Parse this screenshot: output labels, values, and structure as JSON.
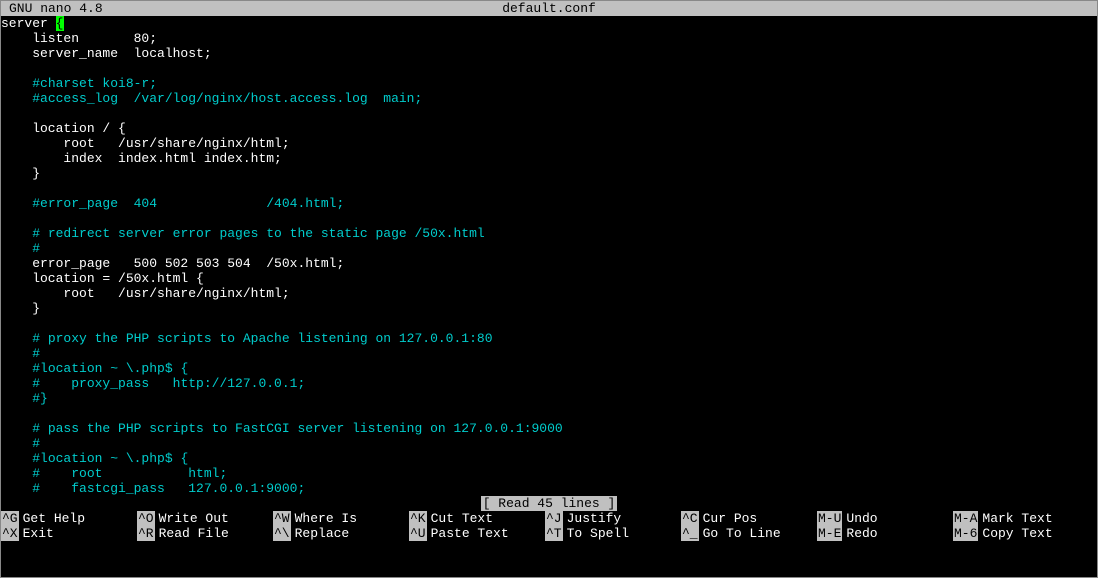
{
  "titlebar": {
    "app": "  GNU nano 4.8",
    "filename": "default.conf"
  },
  "editor": {
    "lines": [
      {
        "segments": [
          {
            "t": "server ",
            "c": "white"
          },
          {
            "t": "{",
            "c": "white",
            "cursor": true
          }
        ]
      },
      {
        "segments": [
          {
            "t": "    listen       80;",
            "c": "white"
          }
        ]
      },
      {
        "segments": [
          {
            "t": "    server_name  localhost;",
            "c": "white"
          }
        ]
      },
      {
        "segments": [
          {
            "t": "",
            "c": "white"
          }
        ]
      },
      {
        "segments": [
          {
            "t": "    ",
            "c": "white"
          },
          {
            "t": "#charset koi8-r;",
            "c": "cyan"
          }
        ]
      },
      {
        "segments": [
          {
            "t": "    ",
            "c": "white"
          },
          {
            "t": "#access_log  /var/log/nginx/host.access.log  main;",
            "c": "cyan"
          }
        ]
      },
      {
        "segments": [
          {
            "t": "",
            "c": "white"
          }
        ]
      },
      {
        "segments": [
          {
            "t": "    location / {",
            "c": "white"
          }
        ]
      },
      {
        "segments": [
          {
            "t": "        root   /usr/share/nginx/html;",
            "c": "white"
          }
        ]
      },
      {
        "segments": [
          {
            "t": "        index  index.html index.htm;",
            "c": "white"
          }
        ]
      },
      {
        "segments": [
          {
            "t": "    }",
            "c": "white"
          }
        ]
      },
      {
        "segments": [
          {
            "t": "",
            "c": "white"
          }
        ]
      },
      {
        "segments": [
          {
            "t": "    ",
            "c": "white"
          },
          {
            "t": "#error_page  404              /404.html;",
            "c": "cyan"
          }
        ]
      },
      {
        "segments": [
          {
            "t": "",
            "c": "white"
          }
        ]
      },
      {
        "segments": [
          {
            "t": "    ",
            "c": "white"
          },
          {
            "t": "# redirect server error pages to the static page /50x.html",
            "c": "cyan"
          }
        ]
      },
      {
        "segments": [
          {
            "t": "    ",
            "c": "white"
          },
          {
            "t": "#",
            "c": "cyan"
          }
        ]
      },
      {
        "segments": [
          {
            "t": "    error_page   500 502 503 504  /50x.html;",
            "c": "white"
          }
        ]
      },
      {
        "segments": [
          {
            "t": "    location = /50x.html {",
            "c": "white"
          }
        ]
      },
      {
        "segments": [
          {
            "t": "        root   /usr/share/nginx/html;",
            "c": "white"
          }
        ]
      },
      {
        "segments": [
          {
            "t": "    }",
            "c": "white"
          }
        ]
      },
      {
        "segments": [
          {
            "t": "",
            "c": "white"
          }
        ]
      },
      {
        "segments": [
          {
            "t": "    ",
            "c": "white"
          },
          {
            "t": "# proxy the PHP scripts to Apache listening on 127.0.0.1:80",
            "c": "cyan"
          }
        ]
      },
      {
        "segments": [
          {
            "t": "    ",
            "c": "white"
          },
          {
            "t": "#",
            "c": "cyan"
          }
        ]
      },
      {
        "segments": [
          {
            "t": "    ",
            "c": "white"
          },
          {
            "t": "#location ~ \\.php$ {",
            "c": "cyan"
          }
        ]
      },
      {
        "segments": [
          {
            "t": "    ",
            "c": "white"
          },
          {
            "t": "#    proxy_pass   http://127.0.0.1;",
            "c": "cyan"
          }
        ]
      },
      {
        "segments": [
          {
            "t": "    ",
            "c": "white"
          },
          {
            "t": "#}",
            "c": "cyan"
          }
        ]
      },
      {
        "segments": [
          {
            "t": "",
            "c": "white"
          }
        ]
      },
      {
        "segments": [
          {
            "t": "    ",
            "c": "white"
          },
          {
            "t": "# pass the PHP scripts to FastCGI server listening on 127.0.0.1:9000",
            "c": "cyan"
          }
        ]
      },
      {
        "segments": [
          {
            "t": "    ",
            "c": "white"
          },
          {
            "t": "#",
            "c": "cyan"
          }
        ]
      },
      {
        "segments": [
          {
            "t": "    ",
            "c": "white"
          },
          {
            "t": "#location ~ \\.php$ {",
            "c": "cyan"
          }
        ]
      },
      {
        "segments": [
          {
            "t": "    ",
            "c": "white"
          },
          {
            "t": "#    root           html;",
            "c": "cyan"
          }
        ]
      },
      {
        "segments": [
          {
            "t": "    ",
            "c": "white"
          },
          {
            "t": "#    fastcgi_pass   127.0.0.1:9000;",
            "c": "cyan"
          }
        ]
      }
    ]
  },
  "status": {
    "message": "[ Read 45 lines ]"
  },
  "shortcuts": {
    "row1": [
      {
        "key": "^G",
        "label": "Get Help"
      },
      {
        "key": "^O",
        "label": "Write Out"
      },
      {
        "key": "^W",
        "label": "Where Is"
      },
      {
        "key": "^K",
        "label": "Cut Text"
      },
      {
        "key": "^J",
        "label": "Justify"
      },
      {
        "key": "^C",
        "label": "Cur Pos"
      },
      {
        "key": "M-U",
        "label": "Undo"
      },
      {
        "key": "M-A",
        "label": "Mark Text"
      }
    ],
    "row2": [
      {
        "key": "^X",
        "label": "Exit"
      },
      {
        "key": "^R",
        "label": "Read File"
      },
      {
        "key": "^\\",
        "label": "Replace"
      },
      {
        "key": "^U",
        "label": "Paste Text"
      },
      {
        "key": "^T",
        "label": "To Spell"
      },
      {
        "key": "^_",
        "label": "Go To Line"
      },
      {
        "key": "M-E",
        "label": "Redo"
      },
      {
        "key": "M-6",
        "label": "Copy Text"
      }
    ]
  }
}
